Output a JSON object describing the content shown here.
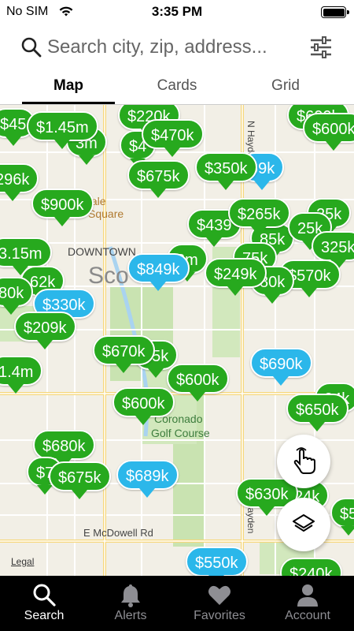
{
  "status_bar": {
    "carrier": "No SIM",
    "time": "3:35 PM"
  },
  "search": {
    "placeholder": "Search city, zip, address..."
  },
  "tabs": [
    {
      "label": "Map",
      "active": true
    },
    {
      "label": "Cards",
      "active": false
    },
    {
      "label": "Grid",
      "active": false
    }
  ],
  "map": {
    "labels": {
      "downtown": "DOWNTOWN",
      "city_fragment": "Sco",
      "coronado_line1": "Coronado",
      "coronado_line2": "Golf Course",
      "mcdowell": "E McDowell Rd",
      "hayden_top": "N Hayden",
      "hayden_bottom": "N Hayden",
      "square_fragment": "Square",
      "fale_fragment": "fale",
      "legal": "Legal"
    },
    "pins": {
      "p45": "$45",
      "p145m": "$1.45m",
      "p220k": "$220k",
      "p600k_tr": "$600k",
      "p470k": "$470k",
      "p3m": "3m",
      "p4": "$4",
      "p296k": "296k",
      "p675k_top": "$675k",
      "p350k": "$350k",
      "p69k": "69k",
      "p900k": "$900k",
      "p265k": "$265k",
      "p439": "$439",
      "p25k": "25k",
      "p85k": "85k",
      "p315m": "3.15m",
      "p849k": "$849k",
      "p75k": "75k",
      "p3m2": "3m",
      "p325k": "325k",
      "p249k": "$249k",
      "p80k": "80k",
      "p570k": "$570k",
      "p62k": "62k",
      "p80k_left": "80k",
      "p330k": "$330k",
      "p209k": "$209k",
      "p670k": "$670k",
      "p05k": "05k",
      "p690k": "$690k",
      "p14m": "1.4m",
      "p600k_mid": "$600k",
      "p600k_left": "$600k",
      "p650k": "$650k",
      "p680k": "$680k",
      "p7": "$7",
      "p675k_low": "$675k",
      "p689k": "$689k",
      "p630k": "$630k",
      "p24k": "24k",
      "p5": "$5",
      "p550k": "$550k",
      "p240k": "$240k"
    }
  },
  "bottom_nav": [
    {
      "label": "Search",
      "icon": "search-icon",
      "active": true
    },
    {
      "label": "Alerts",
      "icon": "bell-icon",
      "active": false
    },
    {
      "label": "Favorites",
      "icon": "heart-icon",
      "active": false
    },
    {
      "label": "Account",
      "icon": "person-icon",
      "active": false
    }
  ],
  "colors": {
    "pin_green": "#27a91e",
    "pin_blue": "#2bb7ea",
    "map_bg": "#f2efe6"
  }
}
